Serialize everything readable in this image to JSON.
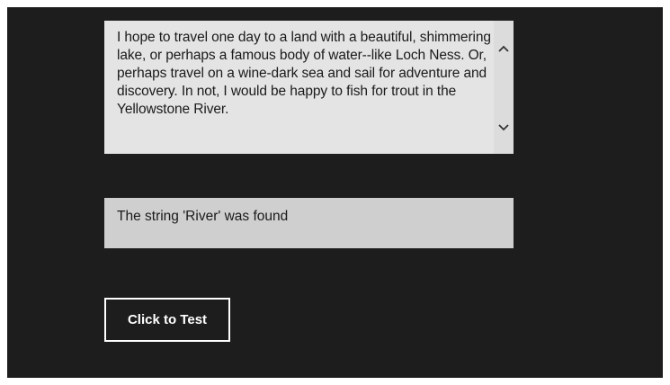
{
  "text_area": {
    "value": "I hope to travel one day to a land with a beautiful, shimmering lake, or perhaps a famous body of water--like Loch Ness. Or, perhaps travel on a wine-dark sea and sail for adventure and discovery. In not, I would be happy to fish for trout in the Yellowstone River."
  },
  "result": {
    "text": "The string 'River' was found"
  },
  "button": {
    "label": "Click to Test"
  },
  "colors": {
    "background": "#1d1d1d",
    "text_area_bg": "#e4e4e4",
    "result_bg": "#cfcfcf",
    "button_border": "#ffffff"
  },
  "icons": {
    "scroll_up": "chevron-up-icon",
    "scroll_down": "chevron-down-icon"
  }
}
